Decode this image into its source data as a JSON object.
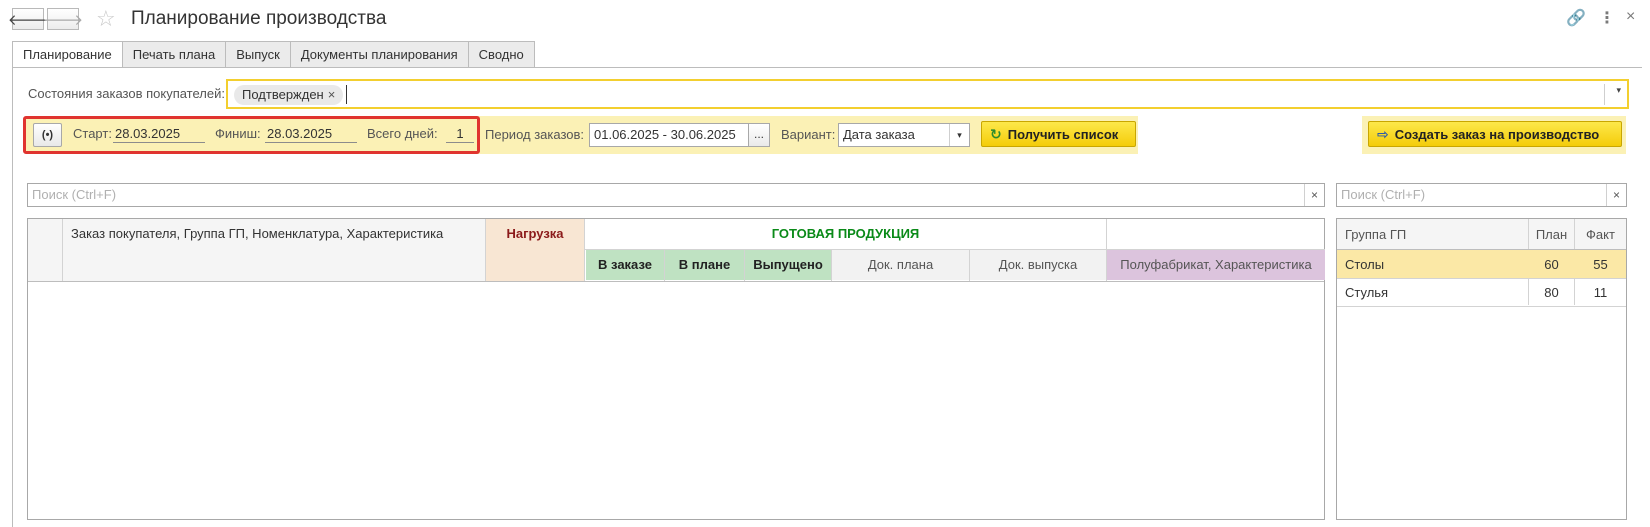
{
  "window": {
    "title": "Планирование производства",
    "back_icon": "arrow-left-icon",
    "forward_icon": "arrow-right-icon",
    "favorite_icon": "star-icon",
    "link_icon": "link-icon",
    "more_icon": "more-vertical-icon",
    "close_icon": "close-icon",
    "back_glyph": "🡐",
    "forward_glyph": "🡒",
    "star_glyph": "☆",
    "link_glyph": "🔗",
    "more_glyph": "⋮",
    "close_glyph": "×"
  },
  "tabs": [
    {
      "label": "Планирование",
      "active": true
    },
    {
      "label": "Печать плана",
      "active": false
    },
    {
      "label": "Выпуск",
      "active": false
    },
    {
      "label": "Документы планирования",
      "active": false
    },
    {
      "label": "Сводно",
      "active": false
    }
  ],
  "order_states": {
    "label": "Состояния заказов покупателей:",
    "chip": "Подтвержден",
    "chip_remove": "×",
    "dropdown_glyph": "▾"
  },
  "date_row": {
    "icon_glyph": "(•)",
    "start_label": "Старт:",
    "start_value": "28.03.2025",
    "finish_label": "Финиш:",
    "finish_value": "28.03.2025",
    "days_label": "Всего дней:",
    "days_value": "1",
    "period_label": "Период заказов:",
    "period_value": "01.06.2025 - 30.06.2025",
    "period_btn": "...",
    "variant_label": "Вариант:",
    "variant_value": "Дата заказа",
    "variant_arrow": "▾",
    "get_list_label": "Получить список",
    "get_list_icon": "↻",
    "create_order_label": "Создать заказ на производство",
    "create_order_icon": "⇨"
  },
  "search": {
    "placeholder": "Поиск (Ctrl+F)",
    "clear": "×"
  },
  "main_table": {
    "col_order": "Заказ покупателя, Группа ГП, Номенклатура, Характеристика",
    "col_load": "Нагрузка",
    "group_finished": "ГОТОВАЯ ПРОДУКЦИЯ",
    "col_in_order": "В заказе",
    "col_in_plan": "В плане",
    "col_released": "Выпущено",
    "col_plan_doc": "Док. плана",
    "col_release_doc": "Док. выпуска",
    "col_semi": "Полуфабрикат, Характеристика",
    "colors": {
      "load_header_bg": "#f8e6d3",
      "load_header_text": "#8b1a1a",
      "finished_text": "#0a8a18",
      "finished_bg": "#bfe2c2",
      "semi_bg": "#dcc4dd"
    }
  },
  "side_table": {
    "col_group": "Группа ГП",
    "col_plan": "План",
    "col_fact": "Факт",
    "rows": [
      {
        "group": "Столы",
        "plan": "60",
        "fact": "55",
        "selected": true
      },
      {
        "group": "Стулья",
        "plan": "80",
        "fact": "11",
        "selected": false
      }
    ]
  }
}
